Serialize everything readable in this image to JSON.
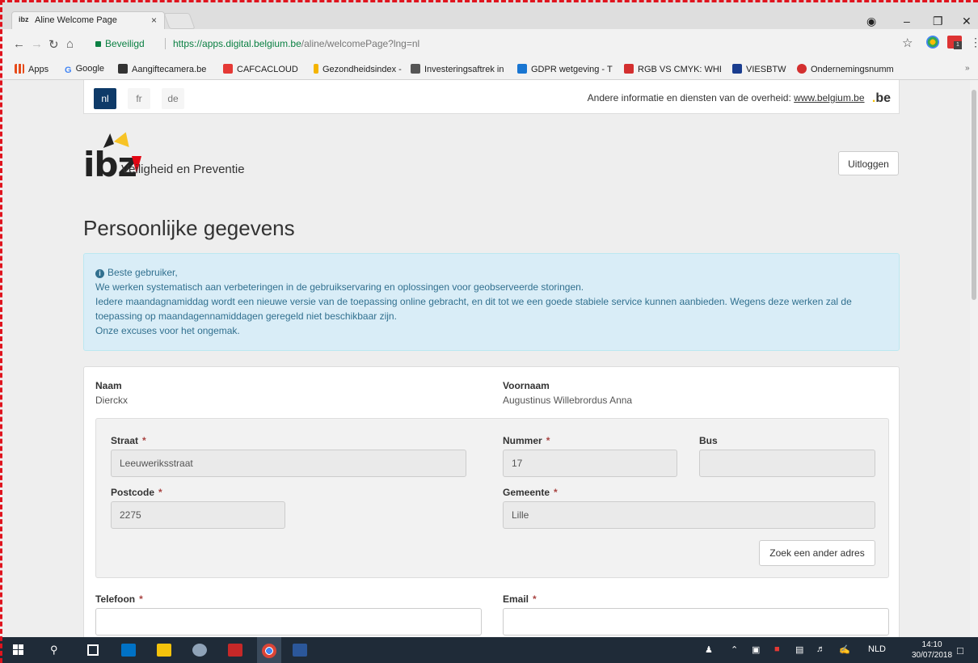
{
  "browser": {
    "tab_title": "Aline Welcome Page",
    "tab_close": "×",
    "tab_favicon_text": "ibz",
    "secure_label": "Beveiligd",
    "url_host": "https://apps.digital.belgium.be",
    "url_path": "/aline/welcomePage?lng=nl"
  },
  "bookmarks": [
    {
      "label": "Apps",
      "color": "#e64a19"
    },
    {
      "label": "Google",
      "color": "#4285f4"
    },
    {
      "label": "Aangiftecamera.be",
      "color": "#333333"
    },
    {
      "label": "CAFCACLOUD",
      "color": "#e53935"
    },
    {
      "label": "Gezondheidsindex -",
      "color": "#f4b400"
    },
    {
      "label": "Investeringsaftrek in",
      "color": "#555555"
    },
    {
      "label": "GDPR wetgeving - T",
      "color": "#1976d2"
    },
    {
      "label": "RGB VS CMYK: WHE",
      "color": "#d32f2f"
    },
    {
      "label": "VIESBTW",
      "color": "#1a3d8f"
    },
    {
      "label": "Ondernemingsnumm",
      "color": "#d32f2f"
    }
  ],
  "languages": [
    "nl",
    "fr",
    "de"
  ],
  "active_language": "nl",
  "gov_text": "Andere informatie en diensten van de overheid:",
  "gov_link": "www.belgium.be",
  "be_logo": "be",
  "logo": {
    "text": "ibz",
    "subtitle": "Veiligheid en Preventie"
  },
  "logout_label": "Uitloggen",
  "page_title": "Persoonlijke gegevens",
  "notice": {
    "icon": "i",
    "heading": "Beste gebruiker,",
    "line1": "We werken systematisch aan verbeteringen in de gebruikservaring en oplossingen voor geobserveerde storingen.",
    "line2": "Iedere maandagnamiddag wordt een nieuwe versie van de toepassing online gebracht, en dit tot we een goede stabiele service kunnen aanbieden. Wegens deze werken zal de toepassing op maandagennamiddagen geregeld niet beschikbaar zijn.",
    "line3": "Onze excuses voor het ongemak."
  },
  "person": {
    "naam_label": "Naam",
    "naam_value": "Dierckx",
    "voornaam_label": "Voornaam",
    "voornaam_value": "Augustinus Willebrordus Anna"
  },
  "address": {
    "straat_label": "Straat",
    "straat_value": "Leeuweriksstraat",
    "nummer_label": "Nummer",
    "nummer_value": "17",
    "bus_label": "Bus",
    "bus_value": "",
    "postcode_label": "Postcode",
    "postcode_value": "2275",
    "gemeente_label": "Gemeente",
    "gemeente_value": "Lille",
    "zoek_button": "Zoek een ander adres"
  },
  "required_mark": "*",
  "contact": {
    "telefoon_label": "Telefoon",
    "telefoon_value": "",
    "email_label": "Email",
    "email_value": ""
  },
  "taskbar": {
    "language": "NLD",
    "time": "14:10",
    "date": "30/07/2018"
  }
}
